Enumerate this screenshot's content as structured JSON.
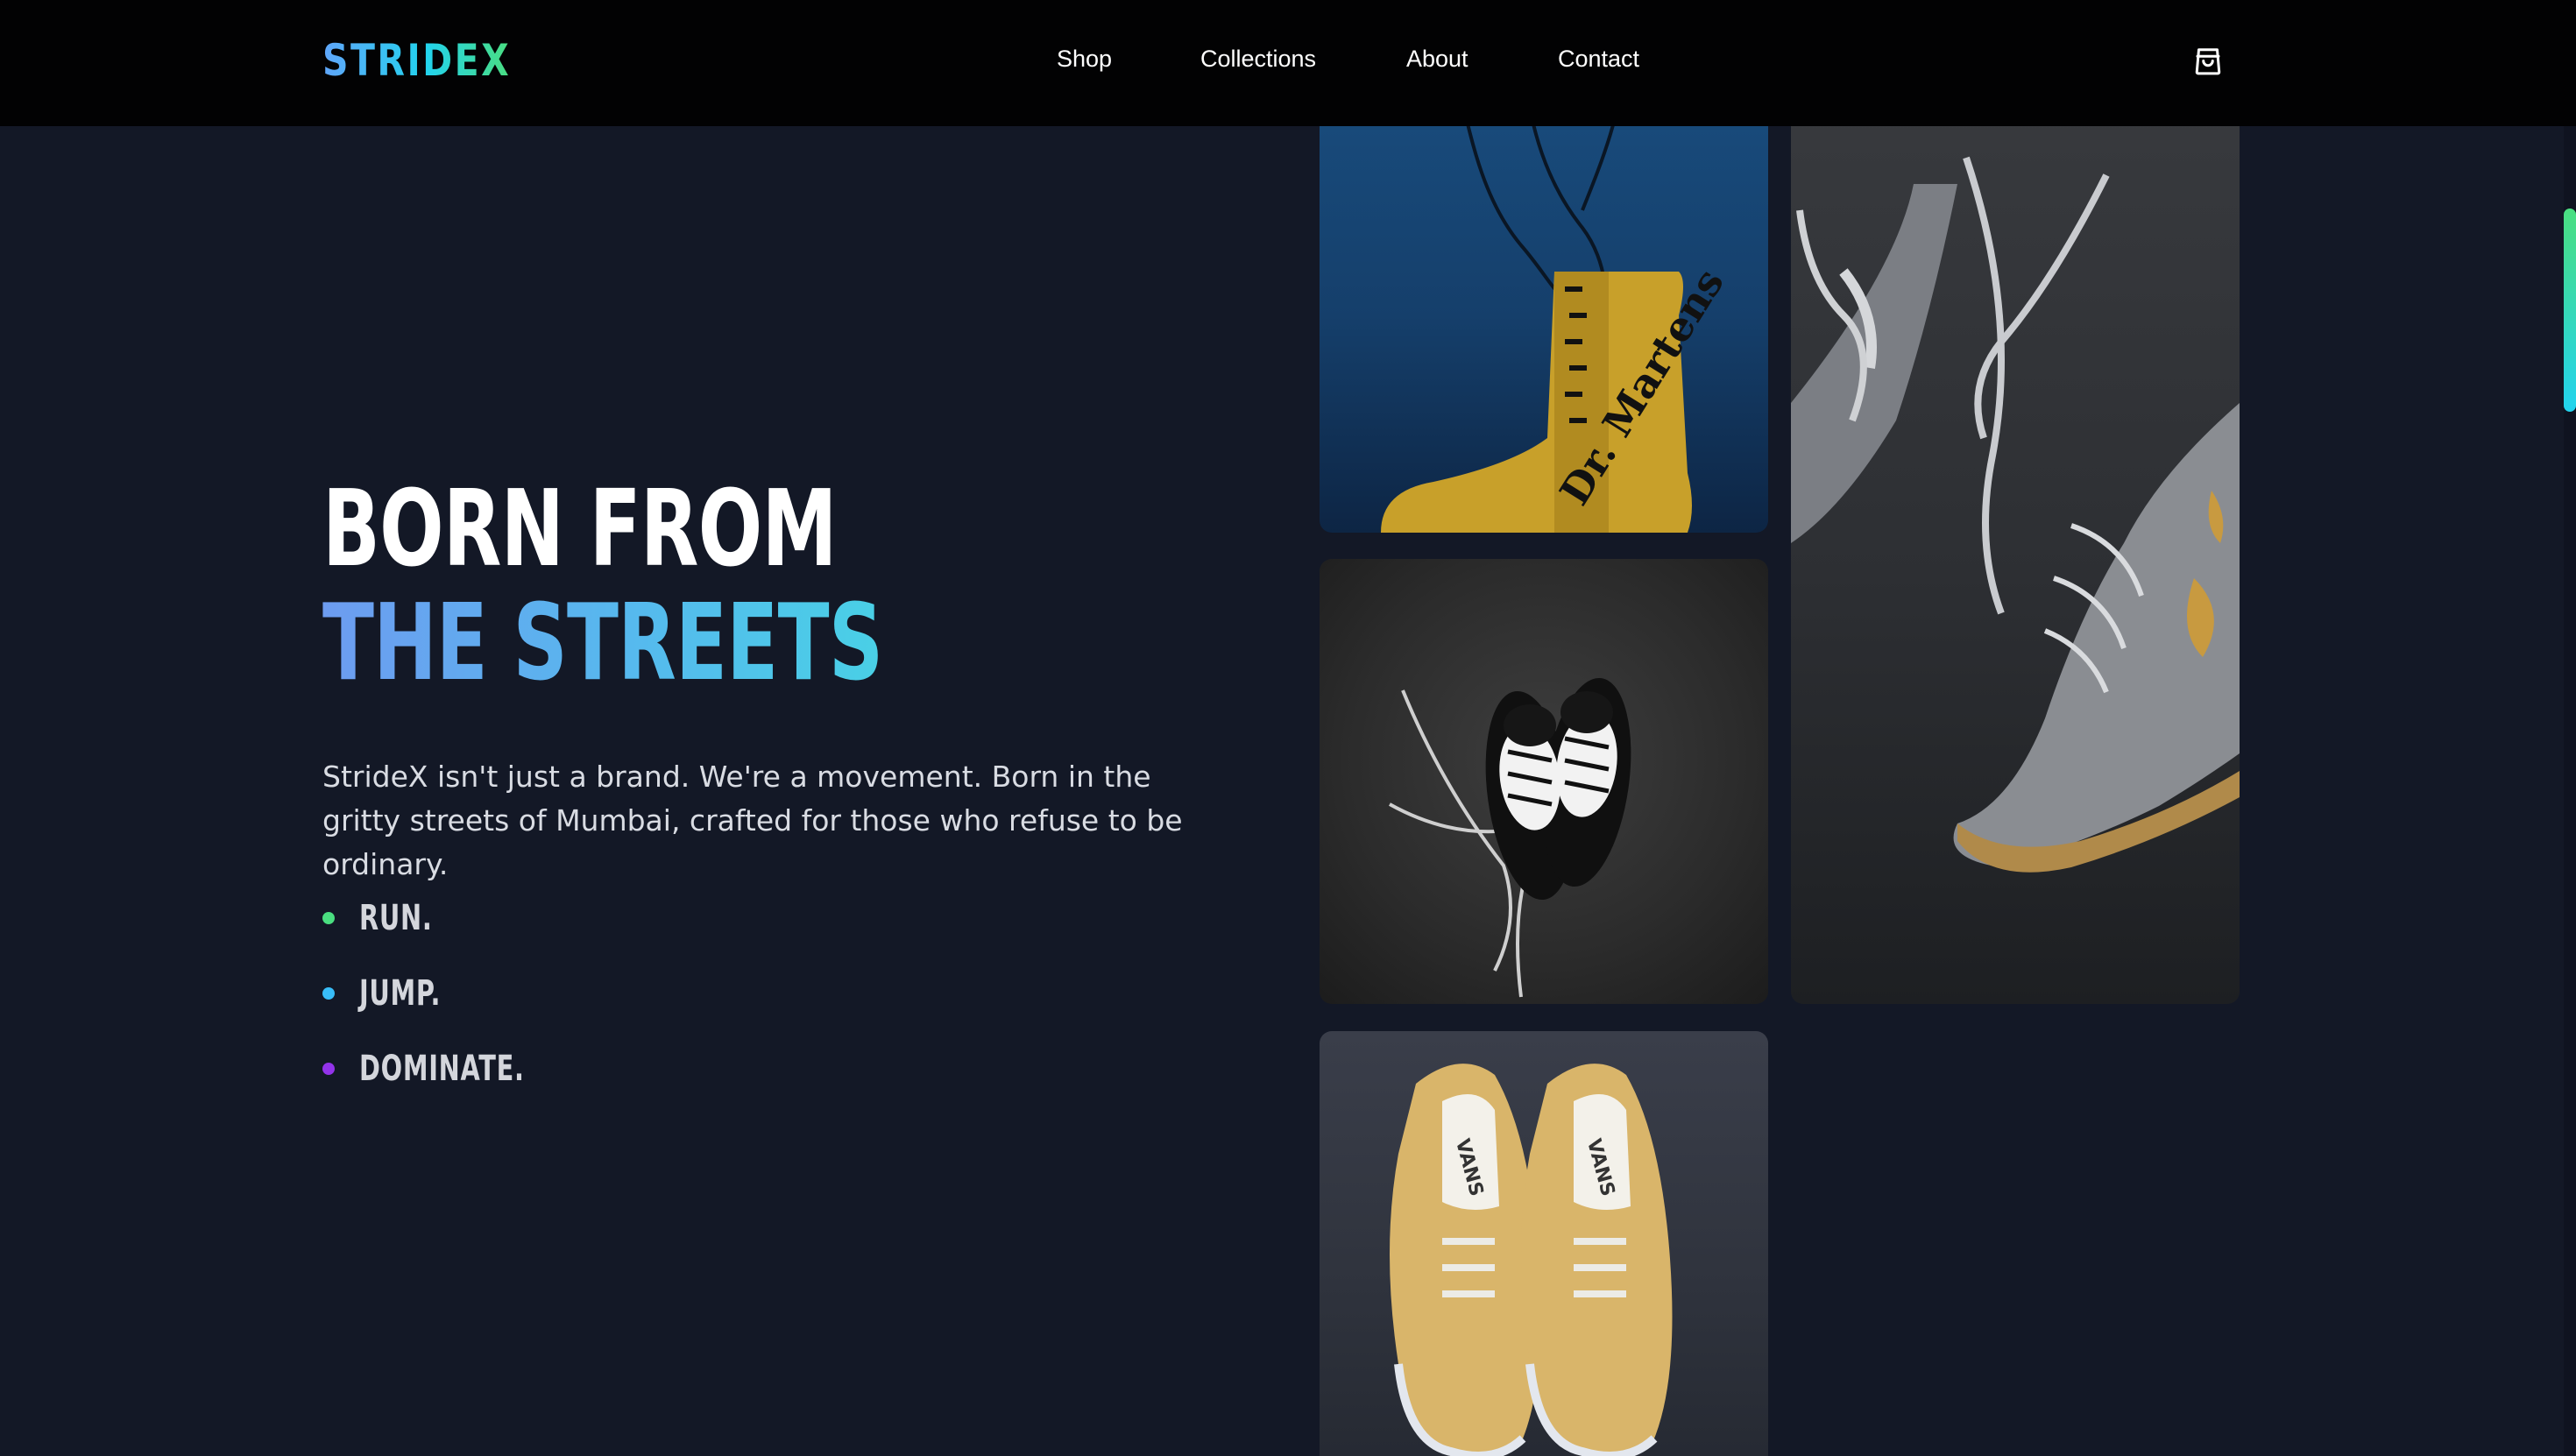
{
  "header": {
    "logo": "STRIDEX",
    "nav": [
      {
        "label": "Shop"
      },
      {
        "label": "Collections"
      },
      {
        "label": "About"
      },
      {
        "label": "Contact"
      }
    ],
    "cart_icon": "shopping-bag-icon"
  },
  "hero": {
    "title_line1": "BORN FROM",
    "title_line2": "THE STREETS",
    "description": "StrideX isn't just a brand. We're a movement. Born in the gritty streets of Mumbai, crafted for those who refuse to be ordinary.",
    "bullets": [
      {
        "text": "RUN.",
        "dot_color": "#4ade80"
      },
      {
        "text": "JUMP.",
        "dot_color": "#38bdf8"
      },
      {
        "text": "DOMINATE.",
        "dot_color": "#9333ea"
      }
    ]
  },
  "gallery": [
    {
      "subject": "yellow-boot-photo"
    },
    {
      "subject": "gray-sneakers-photo"
    },
    {
      "subject": "black-sneakers-photo"
    },
    {
      "subject": "yellow-sneakers-photo"
    }
  ],
  "colors": {
    "background": "#131826",
    "header": "#020203",
    "accent_blue": "#60a5fa",
    "accent_cyan": "#22d3ee",
    "accent_green": "#4ade80"
  },
  "scroll_position": 0.06
}
